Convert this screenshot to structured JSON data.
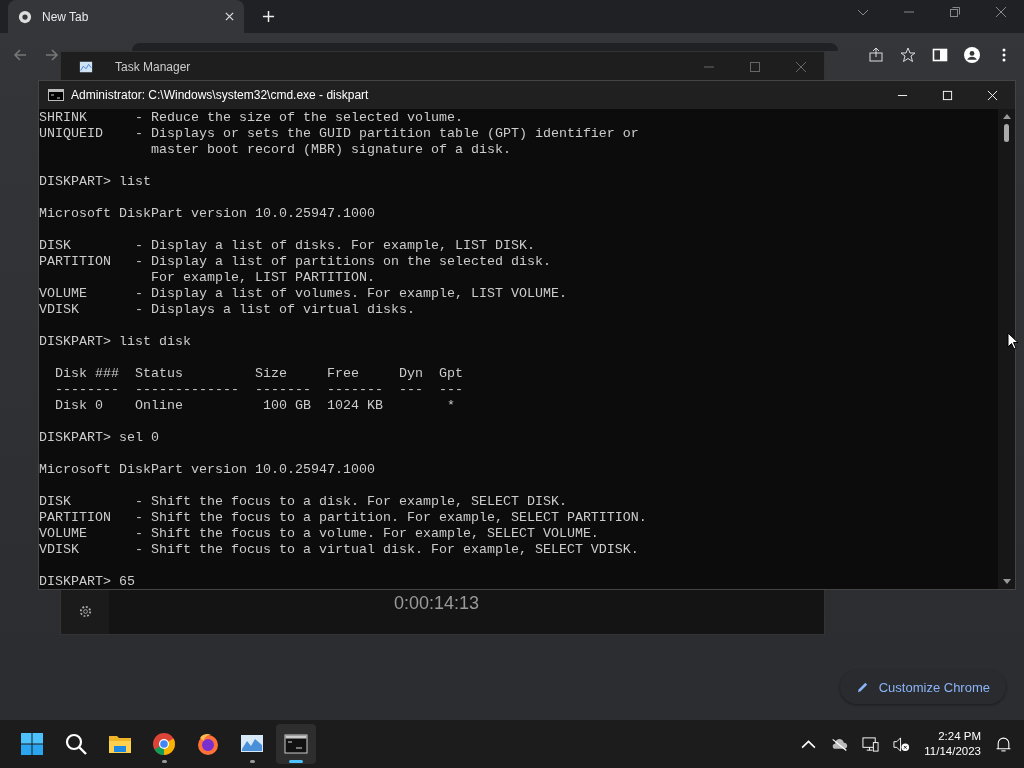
{
  "browser": {
    "tabs": [
      {
        "title": "New Tab",
        "selected": true
      }
    ],
    "customize_button": "Customize Chrome"
  },
  "task_manager": {
    "title": "Task Manager",
    "elapsed": "0:00:14:13"
  },
  "console": {
    "title": "Administrator: C:\\Windows\\system32\\cmd.exe - diskpart",
    "blocks": [
      [
        "SHRINK      - Reduce the size of the selected volume.",
        "UNIQUEID    - Displays or sets the GUID partition table (GPT) identifier or",
        "              master boot record (MBR) signature of a disk."
      ],
      [
        "DISKPART> list"
      ],
      [
        "Microsoft DiskPart version 10.0.25947.1000"
      ],
      [
        "DISK        - Display a list of disks. For example, LIST DISK.",
        "PARTITION   - Display a list of partitions on the selected disk.",
        "              For example, LIST PARTITION.",
        "VOLUME      - Display a list of volumes. For example, LIST VOLUME.",
        "VDISK       - Displays a list of virtual disks."
      ],
      [
        "DISKPART> list disk"
      ],
      [
        "  Disk ###  Status         Size     Free     Dyn  Gpt",
        "  --------  -------------  -------  -------  ---  ---",
        "  Disk 0    Online          100 GB  1024 KB        *"
      ],
      [
        "DISKPART> sel 0"
      ],
      [
        "Microsoft DiskPart version 10.0.25947.1000"
      ],
      [
        "DISK        - Shift the focus to a disk. For example, SELECT DISK.",
        "PARTITION   - Shift the focus to a partition. For example, SELECT PARTITION.",
        "VOLUME      - Shift the focus to a volume. For example, SELECT VOLUME.",
        "VDISK       - Shift the focus to a virtual disk. For example, SELECT VDISK."
      ],
      [
        "DISKPART> 65"
      ]
    ]
  },
  "taskbar": {
    "apps": [
      {
        "kind": "start",
        "running": false,
        "selected": false
      },
      {
        "kind": "search",
        "running": false,
        "selected": false
      },
      {
        "kind": "explorer",
        "running": false,
        "selected": false
      },
      {
        "kind": "chrome",
        "running": true,
        "selected": false
      },
      {
        "kind": "firefox",
        "running": false,
        "selected": false
      },
      {
        "kind": "taskmgr",
        "running": true,
        "selected": false
      },
      {
        "kind": "terminal",
        "running": true,
        "selected": true
      }
    ],
    "time": "2:24 PM",
    "date": "11/14/2023"
  }
}
